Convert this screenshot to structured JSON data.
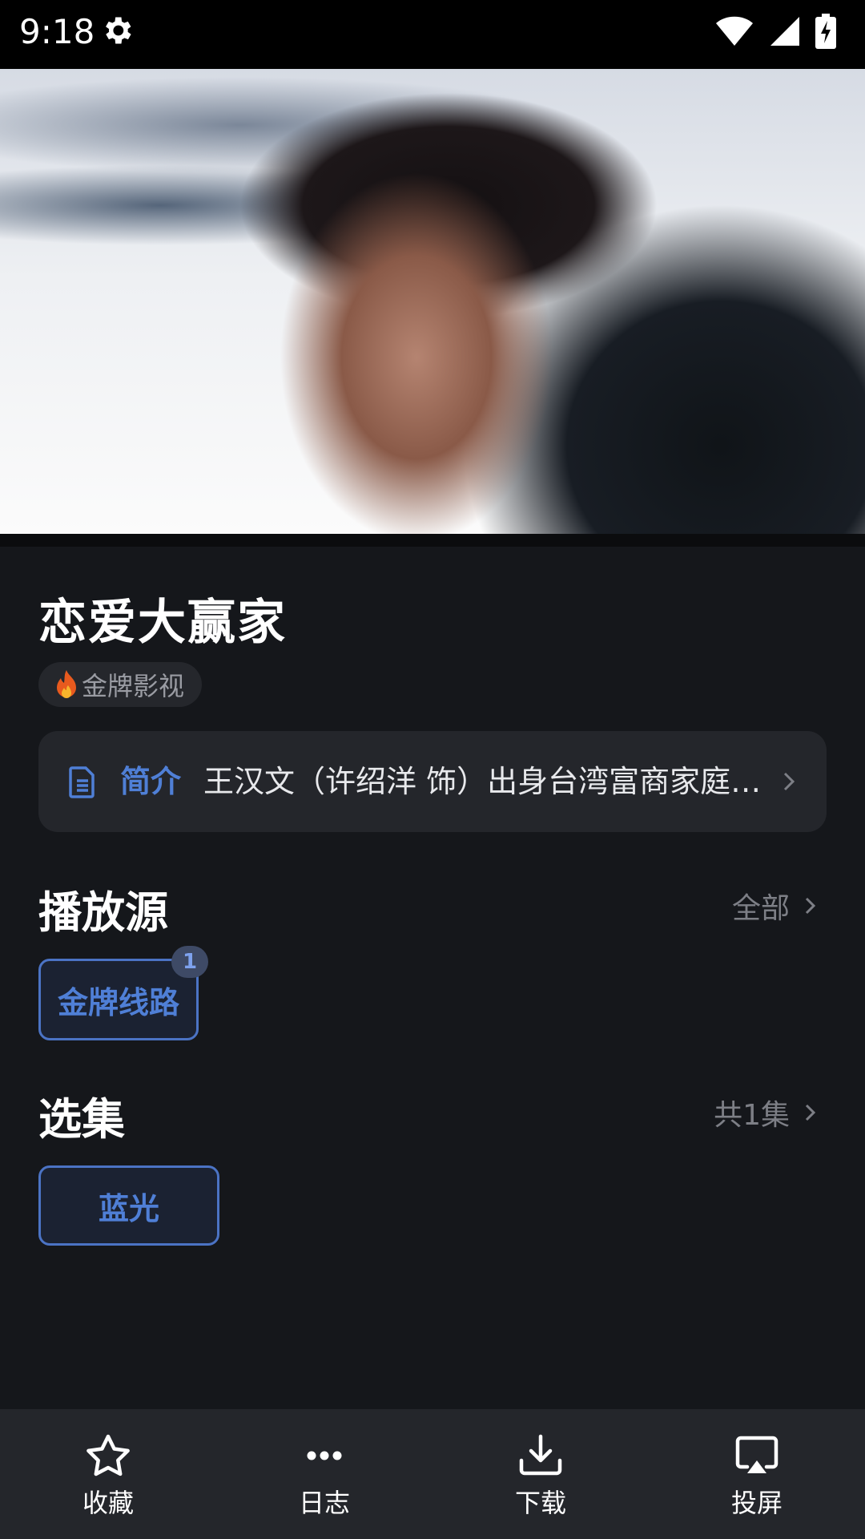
{
  "status_bar": {
    "time": "9:18"
  },
  "movie": {
    "title": "恋爱大赢家",
    "source_tag": "金牌影视"
  },
  "intro": {
    "label": "简介",
    "text": "王汉文（许绍洋 饰）出身台湾富商家庭…"
  },
  "play_source": {
    "title": "播放源",
    "link": "全部",
    "item": "金牌线路",
    "badge": "1"
  },
  "episodes": {
    "title": "选集",
    "count": "共1集",
    "item": "蓝光"
  },
  "bottom_nav": {
    "items": [
      {
        "label": "收藏",
        "icon": "star-icon"
      },
      {
        "label": "日志",
        "icon": "more-dots-icon"
      },
      {
        "label": "下载",
        "icon": "download-icon"
      },
      {
        "label": "投屏",
        "icon": "cast-icon"
      }
    ]
  }
}
